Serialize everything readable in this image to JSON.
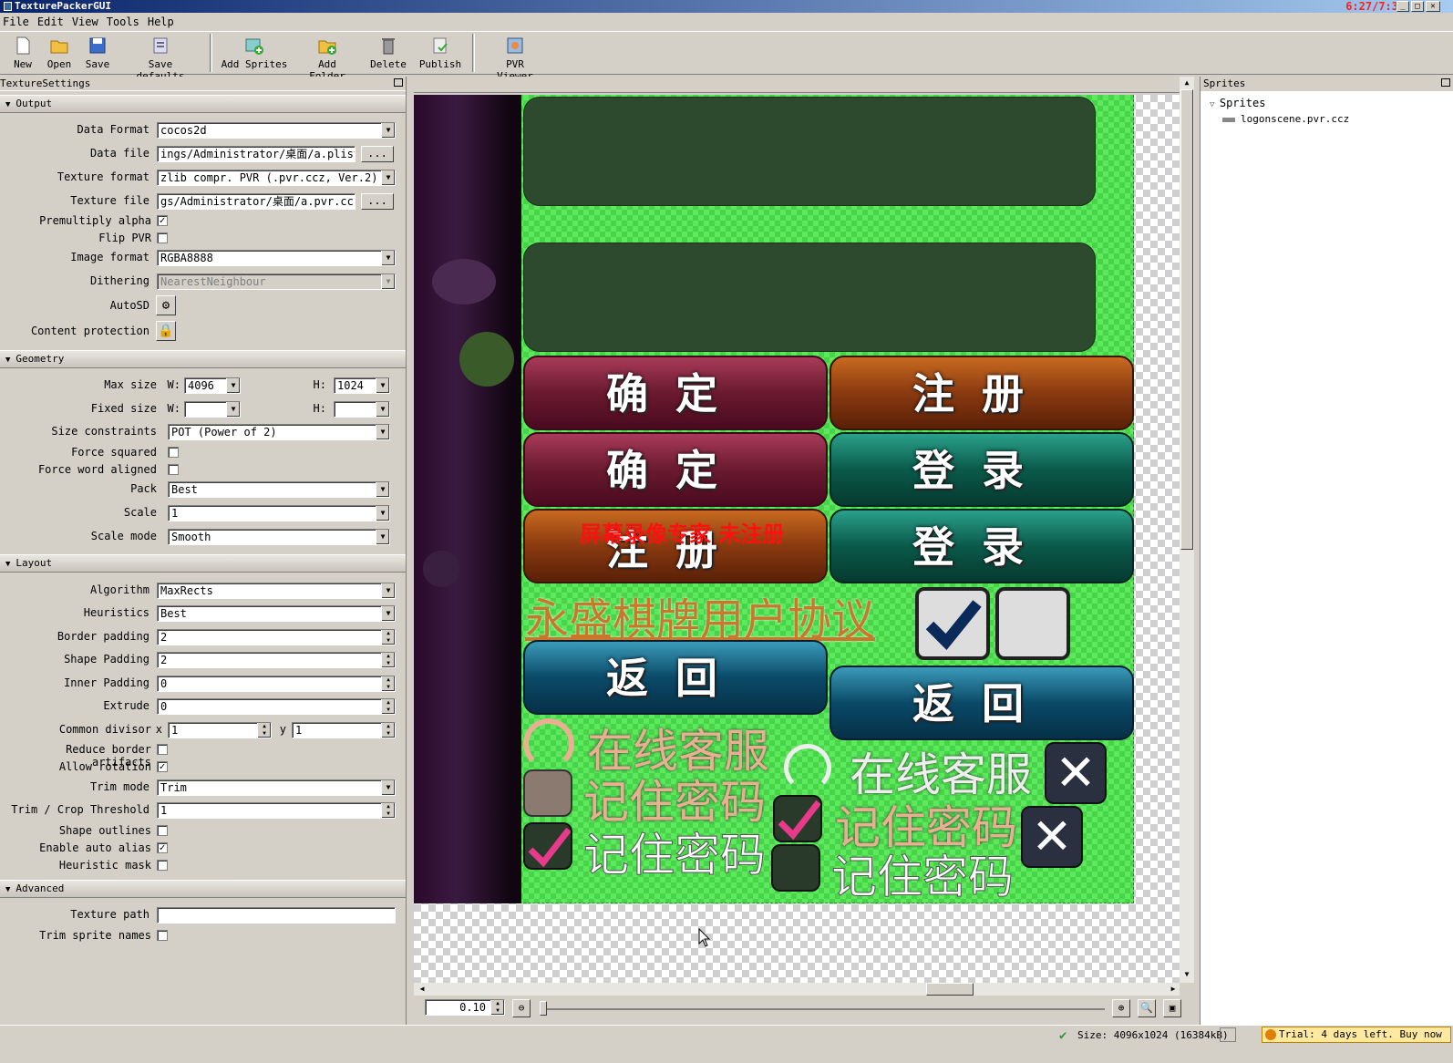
{
  "window": {
    "title": "TexturePackerGUI",
    "clock": "6:27/7:3"
  },
  "menu": [
    "File",
    "Edit",
    "View",
    "Tools",
    "Help"
  ],
  "toolbar": {
    "new": "New",
    "open": "Open",
    "save": "Save",
    "save_defaults": "Save defaults",
    "add_sprites": "Add Sprites",
    "add_folder": "Add Folder",
    "delete": "Delete",
    "publish": "Publish",
    "pvr_viewer": "PVR Viewer"
  },
  "left_panel": {
    "title": "TextureSettings",
    "sections": {
      "output": "Output",
      "geometry": "Geometry",
      "layout": "Layout",
      "advanced": "Advanced"
    },
    "output": {
      "data_format_label": "Data Format",
      "data_format": "cocos2d",
      "data_file_label": "Data file",
      "data_file": "ings/Administrator/桌面/a.plist",
      "texture_format_label": "Texture format",
      "texture_format": "zlib compr. PVR (.pvr.ccz, Ver.2)",
      "texture_file_label": "Texture file",
      "texture_file": "gs/Administrator/桌面/a.pvr.ccz",
      "browse": "...",
      "premultiply_label": "Premultiply alpha",
      "premultiply": true,
      "flip_pvr_label": "Flip PVR",
      "flip_pvr": false,
      "image_format_label": "Image format",
      "image_format": "RGBA8888",
      "dithering_label": "Dithering",
      "dithering": "NearestNeighbour",
      "autosd_label": "AutoSD",
      "content_protection_label": "Content protection"
    },
    "geometry": {
      "max_size_label": "Max size",
      "w_label": "W:",
      "h_label": "H:",
      "max_w": "4096",
      "max_h": "1024",
      "fixed_size_label": "Fixed size",
      "fixed_w": "",
      "fixed_h": "",
      "size_constraints_label": "Size constraints",
      "size_constraints": "POT (Power of 2)",
      "force_squared_label": "Force squared",
      "force_squared": false,
      "force_word_label": "Force word aligned",
      "force_word": false,
      "pack_label": "Pack",
      "pack": "Best",
      "scale_label": "Scale",
      "scale": "1",
      "scale_mode_label": "Scale mode",
      "scale_mode": "Smooth"
    },
    "layout": {
      "algorithm_label": "Algorithm",
      "algorithm": "MaxRects",
      "heuristics_label": "Heuristics",
      "heuristics": "Best",
      "border_padding_label": "Border padding",
      "border_padding": "2",
      "shape_padding_label": "Shape Padding",
      "shape_padding": "2",
      "inner_padding_label": "Inner Padding",
      "inner_padding": "0",
      "extrude_label": "Extrude",
      "extrude": "0",
      "common_divisor_label": "Common divisor",
      "x_label": "x",
      "y_label": "y",
      "divisor_x": "1",
      "divisor_y": "1",
      "reduce_border_label": "Reduce border artifacts",
      "reduce_border": false,
      "allow_rotation_label": "Allow rotation",
      "allow_rotation": true,
      "trim_mode_label": "Trim mode",
      "trim_mode": "Trim",
      "trim_threshold_label": "Trim / Crop Threshold",
      "trim_threshold": "1",
      "shape_outlines_label": "Shape outlines",
      "shape_outlines": false,
      "auto_alias_label": "Enable auto alias",
      "auto_alias": true,
      "heuristic_mask_label": "Heuristic mask",
      "heuristic_mask": false
    },
    "advanced": {
      "texture_path_label": "Texture path",
      "texture_path": "",
      "trim_names_label": "Trim sprite names",
      "trim_names": false
    }
  },
  "atlas": {
    "btn_confirm": "确定",
    "btn_register": "注册",
    "btn_login": "登录",
    "btn_back": "返回",
    "agreement": "永盛棋牌用户协议",
    "online_service": "在线客服",
    "remember_pwd": "记住密码",
    "watermark": "屏幕录像专家  未注册"
  },
  "right_panel": {
    "title": "Sprites",
    "tree_root": "Sprites",
    "items": [
      "logonscene.pvr.ccz"
    ]
  },
  "zoom": {
    "value": "0.10"
  },
  "status": {
    "size": "Size: 4096x1024 (16384kB)",
    "trial": "Trial: 4 days left. Buy now"
  },
  "colors": {
    "atlas_bg": "#5ee85e",
    "watermark": "#ff1010",
    "agreement": "#c87828"
  }
}
